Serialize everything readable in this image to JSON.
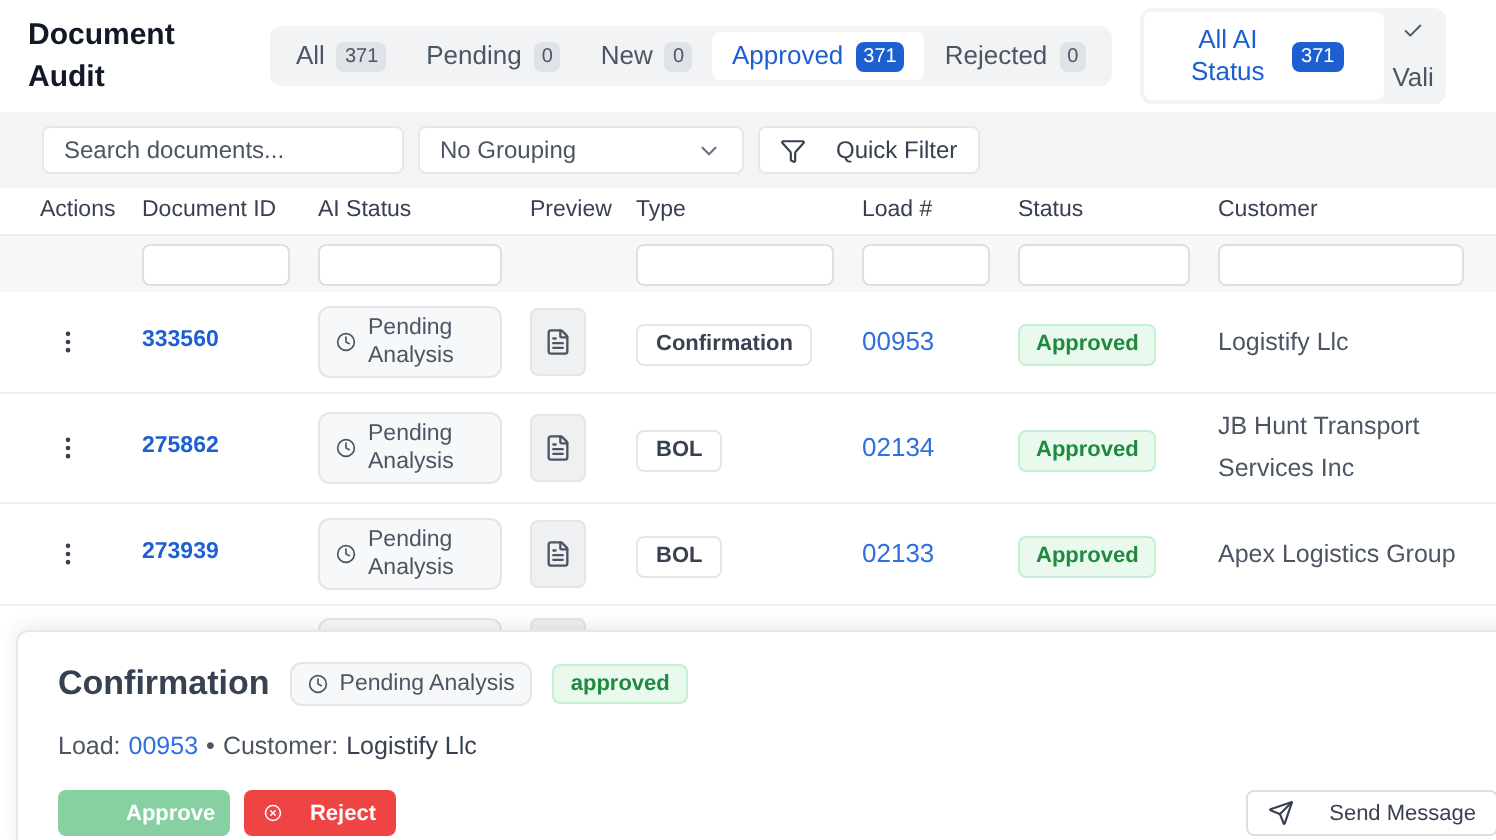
{
  "title": "Document Audit",
  "tabs": [
    {
      "label": "All",
      "count": "371",
      "selected": false
    },
    {
      "label": "Pending",
      "count": "0",
      "selected": false
    },
    {
      "label": "New",
      "count": "0",
      "selected": false
    },
    {
      "label": "Approved",
      "count": "371",
      "selected": true
    },
    {
      "label": "Rejected",
      "count": "0",
      "selected": false
    }
  ],
  "ai_filters": [
    {
      "label": "All AI Status",
      "count": "371",
      "selected": true
    },
    {
      "label": "Vali",
      "selected": false
    }
  ],
  "toolbar": {
    "search_placeholder": "Search documents...",
    "grouping": "No Grouping",
    "quick_filter": "Quick Filter"
  },
  "table": {
    "columns": [
      "Actions",
      "Document ID",
      "AI Status",
      "Preview",
      "Type",
      "Load #",
      "Status",
      "Customer"
    ],
    "rows": [
      {
        "id": "333560",
        "ai_status": "Pending Analysis",
        "type": "Confirmation",
        "load": "00953",
        "status": "Approved",
        "customer": "Logistify Llc"
      },
      {
        "id": "275862",
        "ai_status": "Pending Analysis",
        "type": "BOL",
        "load": "02134",
        "status": "Approved",
        "customer": "JB Hunt Transport Services Inc"
      },
      {
        "id": "273939",
        "ai_status": "Pending Analysis",
        "type": "BOL",
        "load": "02133",
        "status": "Approved",
        "customer": "Apex Logistics Group"
      }
    ]
  },
  "detail": {
    "title": "Confirmation",
    "ai_status": "Pending Analysis",
    "status": "approved",
    "load_label": "Load:",
    "load": "00953",
    "separator": "•",
    "customer_label": "Customer:",
    "customer": "Logistify Llc",
    "approve": "Approve",
    "reject": "Reject",
    "send": "Send Message"
  }
}
